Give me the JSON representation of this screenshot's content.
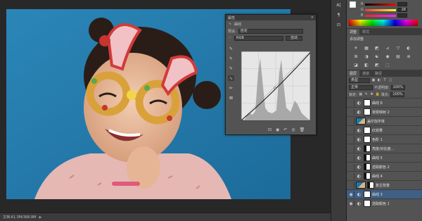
{
  "status_bar": {
    "doc_info": "文档:61.3M/368.8M",
    "arrow": "▶"
  },
  "toolstrip": {
    "buttons": [
      {
        "label": "A|",
        "icon": "character-icon"
      },
      {
        "label": "¶",
        "icon": "paragraph-icon"
      },
      {
        "label": "⊡",
        "icon": "transform-icon"
      }
    ]
  },
  "color_panel": {
    "fg_color": "#ffffff",
    "bg_color": "#e8e8e8",
    "sliders": [
      {
        "label": "R",
        "value": ""
      },
      {
        "label": "G",
        "value": "28"
      },
      {
        "label": "B",
        "value": ""
      }
    ]
  },
  "adjust_panel": {
    "tabs": [
      "调整",
      "样式"
    ],
    "title": "添加调整",
    "icons": [
      "☀",
      "▦",
      "◩",
      "⊿",
      "▽",
      "◐",
      "⊞",
      "◑",
      "☯",
      "◉",
      "▤",
      "⊕",
      "◪",
      "◧",
      "◩",
      "⬚"
    ]
  },
  "layers_panel": {
    "tabs": [
      "图层",
      "通道",
      "路径"
    ],
    "kind_select": "类型",
    "blend_mode": "正常",
    "opacity_label": "不透明度:",
    "opacity_value": "100%",
    "lock_label": "锁定:",
    "fill_label": "填充:",
    "fill_value": "100%",
    "layers": [
      {
        "name": "曲线 6",
        "visible": false,
        "kind": "adjust",
        "mask": "white",
        "selected": false
      },
      {
        "name": "渐变映射 2",
        "visible": false,
        "kind": "adjust",
        "mask": "white",
        "selected": false
      },
      {
        "name": "盖印加字体",
        "visible": false,
        "kind": "image",
        "mask": "",
        "selected": false
      },
      {
        "name": "红效果",
        "visible": false,
        "kind": "adjust",
        "mask": "white",
        "selected": false
      },
      {
        "name": "色阶 1",
        "visible": false,
        "kind": "adjust",
        "mask": "white",
        "selected": false
      },
      {
        "name": "亮度/对比度...",
        "visible": false,
        "kind": "adjust",
        "mask": "dark",
        "selected": false
      },
      {
        "name": "曲线 5",
        "visible": false,
        "kind": "adjust",
        "mask": "dark",
        "selected": false
      },
      {
        "name": "选取颜色 2",
        "visible": false,
        "kind": "adjust",
        "mask": "dark",
        "selected": false
      },
      {
        "name": "曲线 4",
        "visible": false,
        "kind": "adjust",
        "mask": "dark",
        "selected": false
      },
      {
        "name": "复古背景",
        "visible": false,
        "kind": "image",
        "mask": "dark",
        "selected": false
      },
      {
        "name": "曲线 3",
        "visible": true,
        "kind": "adjust",
        "mask": "white",
        "selected": true
      },
      {
        "name": "选取颜色 1",
        "visible": true,
        "kind": "adjust",
        "mask": "white",
        "selected": false
      }
    ]
  },
  "properties_panel": {
    "title": "属性",
    "close": "×",
    "subtitle": "曲线",
    "preset_label": "预设:",
    "preset_value": "自定",
    "channel_value": "RGB",
    "auto_button": "自动",
    "tools": [
      "✎",
      "✎",
      "✎",
      "∿",
      "✏",
      "⊠"
    ],
    "bottom_icons": [
      "⊡",
      "◉",
      "↶",
      "◎",
      "🗑"
    ]
  }
}
